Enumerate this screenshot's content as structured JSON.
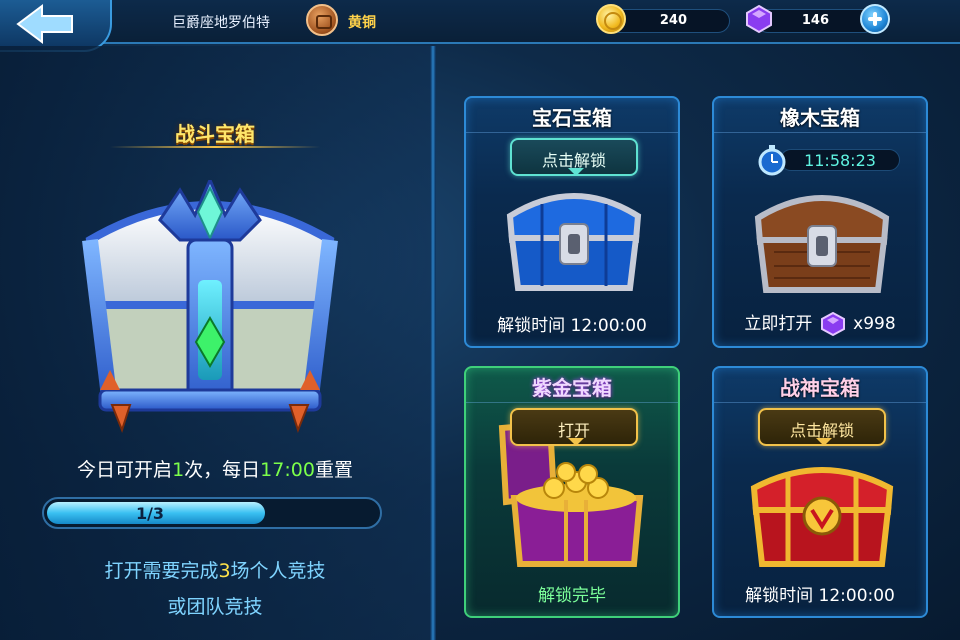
{
  "header": {
    "player_name": "巨爵座地罗伯特",
    "rank_label": "黄铜",
    "coins": "240",
    "gems": "146"
  },
  "left_panel": {
    "title": "战斗宝箱",
    "info_prefix": "今日可开启",
    "info_count": "1",
    "info_mid": "次，每日",
    "info_time": "17:00",
    "info_suffix": "重置",
    "progress_text": "1/3",
    "progress_fraction": 0.33,
    "req_prefix": "打开需要完成",
    "req_count": "3",
    "req_suffix": "场个人竞技",
    "req_line2": "或团队竞技"
  },
  "cards": [
    {
      "title": "宝石宝箱",
      "action": "点击解锁",
      "footer": "解锁时间 12:00:00"
    },
    {
      "title": "橡木宝箱",
      "timer": "11:58:23",
      "footer_prefix": "立即打开",
      "footer_cost": "x998"
    },
    {
      "title": "紫金宝箱",
      "action": "打开",
      "footer": "解锁完毕"
    },
    {
      "title": "战神宝箱",
      "action": "点击解锁",
      "footer": "解锁时间 12:00:00"
    }
  ],
  "colors": {
    "accent_blue": "#2d8ad6",
    "highlight_green": "#7cff4a",
    "highlight_yellow": "#ffe34a",
    "timer_cyan": "#5ff4e2"
  },
  "icons": [
    "back-arrow-icon",
    "rank-badge-icon",
    "coin-icon",
    "gem-icon",
    "plus-icon",
    "stopwatch-icon"
  ]
}
